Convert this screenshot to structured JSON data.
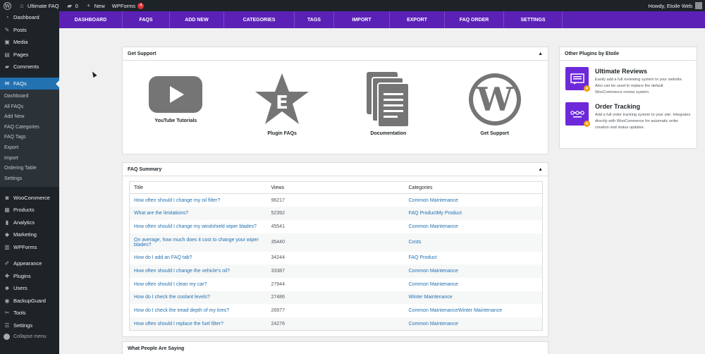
{
  "admin_bar": {
    "site_name": "Ultimate FAQ",
    "comments_count": "0",
    "new_label": "New",
    "wpforms_label": "WPForms",
    "wpforms_badge": "4",
    "howdy": "Howdy, Etoile Web"
  },
  "sidebar": {
    "top_items": [
      {
        "label": "Dashboard",
        "icon": "dashboard-icon"
      },
      {
        "label": "Posts",
        "icon": "pin-icon"
      },
      {
        "label": "Media",
        "icon": "media-icon"
      },
      {
        "label": "Pages",
        "icon": "page-icon"
      },
      {
        "label": "Comments",
        "icon": "comment-icon"
      }
    ],
    "current": {
      "label": "FAQs",
      "icon": "faq-icon"
    },
    "submenu": [
      "Dashboard",
      "All FAQs",
      "Add New",
      "FAQ Categories",
      "FAQ Tags",
      "Export",
      "Import",
      "Ordering Table",
      "Settings"
    ],
    "group2": [
      {
        "label": "WooCommerce",
        "icon": "woocommerce-icon"
      },
      {
        "label": "Products",
        "icon": "products-icon"
      },
      {
        "label": "Analytics",
        "icon": "analytics-icon"
      },
      {
        "label": "Marketing",
        "icon": "marketing-icon"
      },
      {
        "label": "WPForms",
        "icon": "wpforms-icon"
      }
    ],
    "group3": [
      {
        "label": "Appearance",
        "icon": "appearance-icon"
      },
      {
        "label": "Plugins",
        "icon": "plugins-icon"
      },
      {
        "label": "Users",
        "icon": "users-icon"
      },
      {
        "label": "BackupGuard",
        "icon": "backup-icon"
      },
      {
        "label": "Tools",
        "icon": "tools-icon"
      },
      {
        "label": "Settings",
        "icon": "settings-icon"
      }
    ],
    "collapse_label": "Collapse menu"
  },
  "plugin_nav": [
    "DASHBOARD",
    "FAQS",
    "ADD NEW",
    "CATEGORIES",
    "TAGS",
    "IMPORT",
    "EXPORT",
    "FAQ ORDER",
    "SETTINGS"
  ],
  "support": {
    "title": "Get Support",
    "toggle": "▲",
    "items": [
      {
        "label": "YouTube Tutorials",
        "icon": "youtube-icon"
      },
      {
        "label": "Plugin FAQs",
        "icon": "star-icon"
      },
      {
        "label": "Documentation",
        "icon": "documentation-icon"
      },
      {
        "label": "Get Support",
        "icon": "wordpress-icon"
      }
    ]
  },
  "summary": {
    "title": "FAQ Summary",
    "toggle": "▲",
    "columns": [
      "Title",
      "Views",
      "Categories"
    ],
    "rows": [
      {
        "title": "How often should I change my oil filter?",
        "views": "96217",
        "categories": "Common Maintenance"
      },
      {
        "title": "What are the limitations?",
        "views": "52392",
        "categories": "FAQ ProductMy Product"
      },
      {
        "title": "How often should I change my windshield wiper blades?",
        "views": "45541",
        "categories": "Common Maintenance"
      },
      {
        "title": "On average, how much does it cost to change your wiper blades?",
        "views": "35440",
        "categories": "Costs"
      },
      {
        "title": "How do I add an FAQ tab?",
        "views": "34244",
        "categories": "FAQ Product"
      },
      {
        "title": "How often should I change the vehicle's oil?",
        "views": "33387",
        "categories": "Common Maintenance"
      },
      {
        "title": "How often should I clean my car?",
        "views": "27944",
        "categories": "Common Maintenance"
      },
      {
        "title": "How do I check the coolant levels?",
        "views": "27486",
        "categories": "Winter Maintenance"
      },
      {
        "title": "How do I check the tread depth of my tires?",
        "views": "26977",
        "categories": "Common MaintenanceWinter Maintenance"
      },
      {
        "title": "How often should I replace the fuel filter?",
        "views": "24276",
        "categories": "Common Maintenance"
      }
    ]
  },
  "people": {
    "title": "What People Are Saying"
  },
  "other_plugins": {
    "title": "Other Plugins by Etoile",
    "items": [
      {
        "title": "Ultimate Reviews",
        "desc": "Easily add a full reviewing system to your website. Also can be used to replace the default WooCommerce review system.",
        "icon": "reviews-icon"
      },
      {
        "title": "Order Tracking",
        "desc": "Add a full order tracking system to your site. Integrates directly with WooCommerce for automatic order creation and status updates.",
        "icon": "order-tracking-icon"
      }
    ]
  },
  "colors": {
    "accent": "#5b21b6",
    "link": "#2271b1",
    "sidebar_bg": "#1d2327",
    "current_menu": "#2271b1"
  }
}
